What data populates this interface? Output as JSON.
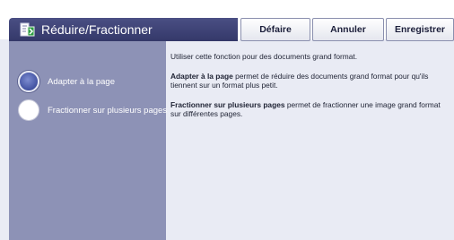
{
  "header": {
    "title": "Réduire/Fractionner",
    "buttons": {
      "undo": "Défaire",
      "cancel": "Annuler",
      "save": "Enregistrer"
    }
  },
  "options": [
    {
      "label": "Adapter à la page",
      "selected": true
    },
    {
      "label": "Fractionner sur plusieurs pages",
      "selected": false
    }
  ],
  "description": {
    "intro": "Utiliser cette fonction pour des documents grand format.",
    "fit_title": "Adapter à la page",
    "fit_text": " permet de réduire des documents grand format pour qu'ils tiennent sur un format plus petit.",
    "split_title": "Fractionner sur plusieurs pages",
    "split_text": " permet de fractionner une image grand format sur différentes pages."
  },
  "colors": {
    "title_bar": "#3d4176",
    "left_panel": "#8d92b6",
    "content_bg": "#e9ebf4",
    "selected_radio": "#4a5aa8"
  },
  "icons": {
    "title": "reduce-split-icon"
  }
}
